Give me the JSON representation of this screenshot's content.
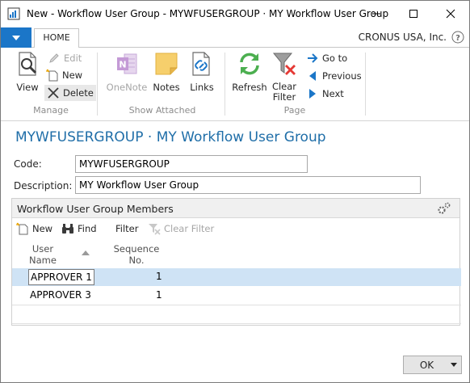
{
  "window": {
    "title": "New - Workflow User Group - MYWFUSERGROUP · MY Workflow User Group"
  },
  "ribbon": {
    "home_tab": "HOME",
    "company": "CRONUS USA, Inc.",
    "manage": {
      "view": "View",
      "edit": "Edit",
      "new": "New",
      "delete": "Delete",
      "label": "Manage"
    },
    "show_attached": {
      "onenote": "OneNote",
      "notes": "Notes",
      "links": "Links",
      "label": "Show Attached"
    },
    "page": {
      "refresh": "Refresh",
      "clear_filter_1": "Clear",
      "clear_filter_2": "Filter",
      "goto": "Go to",
      "previous": "Previous",
      "next": "Next",
      "label": "Page"
    }
  },
  "header": {
    "title": "MYWFUSERGROUP · MY Workflow User Group",
    "code_label": "Code:",
    "code_value": "MYWFUSERGROUP",
    "description_label": "Description:",
    "description_value": "MY Workflow User Group"
  },
  "subpage": {
    "title": "Workflow User Group Members",
    "toolbar": {
      "new": "New",
      "find": "Find",
      "filter": "Filter",
      "clear_filter": "Clear Filter"
    },
    "columns": {
      "user_name_1": "User",
      "user_name_2": "Name",
      "sequence_1": "Sequence",
      "sequence_2": "No."
    },
    "rows": [
      {
        "user_name": "APPROVER 1",
        "sequence": "1"
      },
      {
        "user_name": "APPROVER 3",
        "sequence": "1"
      }
    ]
  },
  "footer": {
    "ok": "OK"
  },
  "colors": {
    "accent": "#1b76c8",
    "title": "#1f6ea8",
    "selected_row": "#cfe3f5"
  }
}
